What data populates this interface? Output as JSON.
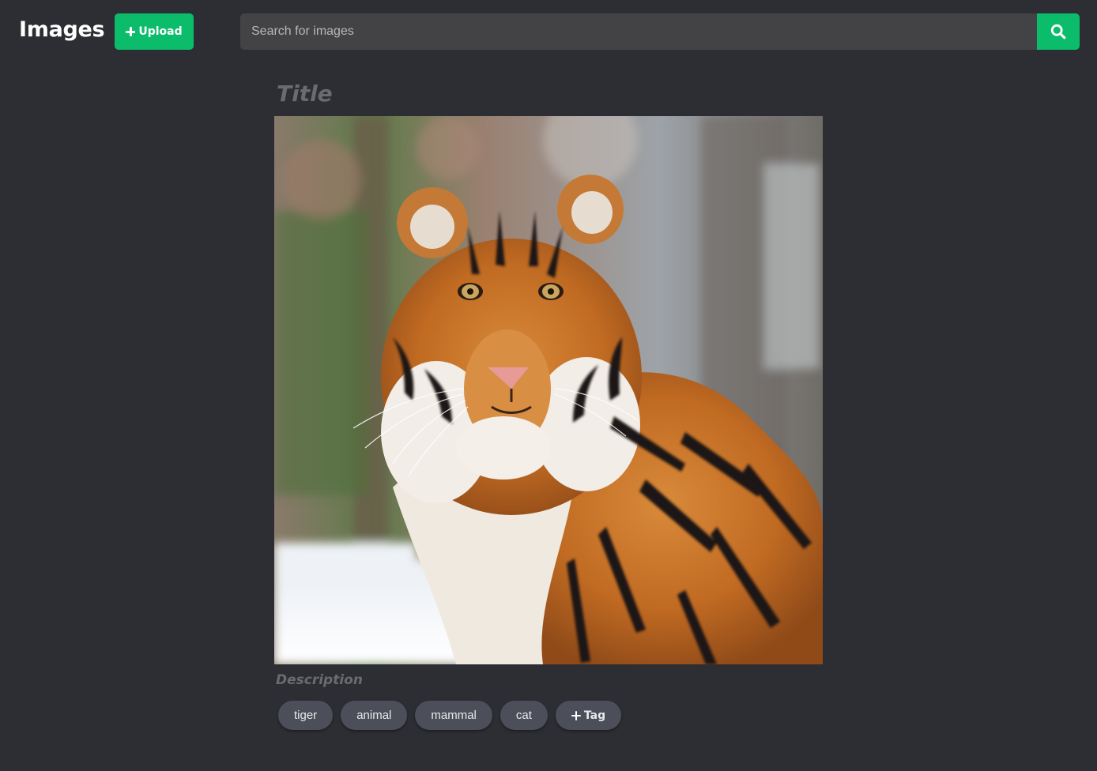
{
  "header": {
    "brand": "Images",
    "upload_label": "Upload",
    "search_placeholder": "Search for images",
    "search_value": ""
  },
  "image": {
    "title_placeholder": "Title",
    "description_placeholder": "Description",
    "subject": "tiger"
  },
  "tags": [
    "tiger",
    "animal",
    "mammal",
    "cat"
  ],
  "add_tag_label": "Tag",
  "colors": {
    "background": "#2d2e33",
    "accent": "#0bbd6b",
    "search_field": "#434346",
    "tag_bg": "#4c4f5a",
    "placeholder_text": "#6a6b70"
  },
  "icons": {
    "upload": "plus-icon",
    "search": "search-icon",
    "add_tag": "plus-icon"
  }
}
